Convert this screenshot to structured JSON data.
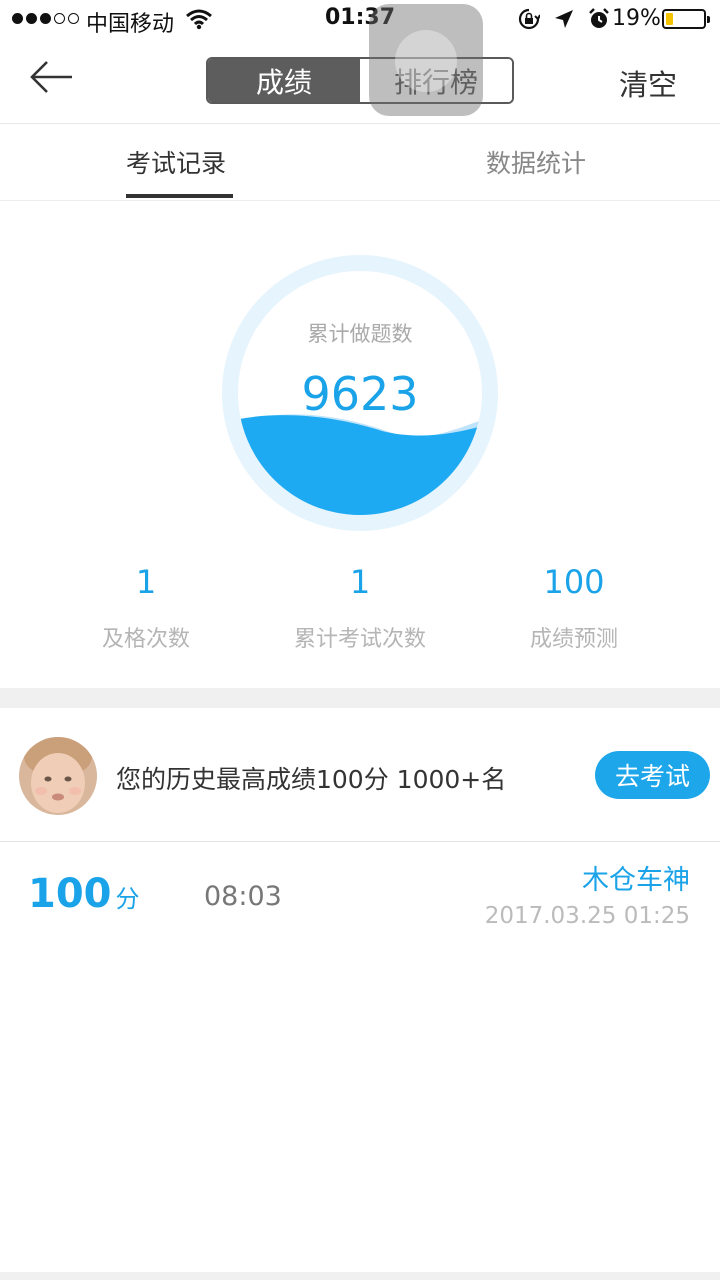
{
  "status_bar": {
    "carrier": "中国移动",
    "time": "01:37",
    "battery_percent": "19%",
    "battery_level": 0.19
  },
  "nav": {
    "segments": [
      "成绩",
      "排行榜"
    ],
    "active_segment": 0,
    "clear_label": "清空"
  },
  "tabs": {
    "items": [
      "考试记录",
      "数据统计"
    ],
    "active": 0
  },
  "gauge": {
    "label": "累计做题数",
    "value": "9623"
  },
  "stats": [
    {
      "value": "1",
      "label": "及格次数"
    },
    {
      "value": "1",
      "label": "累计考试次数"
    },
    {
      "value": "100",
      "label": "成绩预测"
    }
  ],
  "best": {
    "text": "您的历史最高成绩100分  1000+名",
    "button_label": "去考试"
  },
  "record": {
    "score": "100",
    "score_unit": "分",
    "duration": "08:03",
    "rank_title": "木仓车神",
    "datetime": "2017.03.25 01:25"
  },
  "colors": {
    "accent": "#1aa3e8",
    "battery_fill": "#f5c400"
  }
}
